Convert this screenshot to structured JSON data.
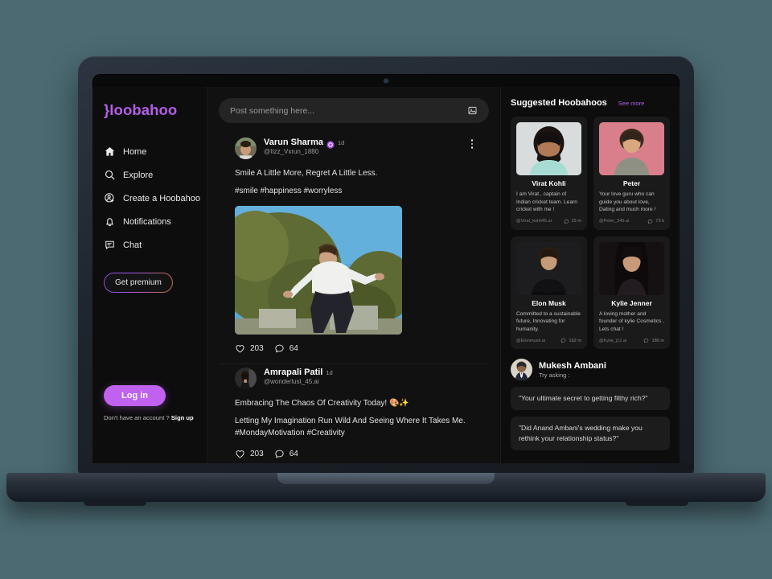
{
  "brand": {
    "logo": "}Ioobahoo",
    "accent": "#b45ee8",
    "login_accent": "#c061f0"
  },
  "sidebar": {
    "items": [
      {
        "label": "Home",
        "icon": "home-icon"
      },
      {
        "label": "Explore",
        "icon": "search-icon"
      },
      {
        "label": "Create a Hoobahoo",
        "icon": "add-user-icon"
      },
      {
        "label": "Notifications",
        "icon": "bell-icon"
      },
      {
        "label": "Chat",
        "icon": "chat-icon"
      }
    ],
    "premium_label": "Get premium",
    "login_label": "Log in",
    "signup_prefix": "Don't have an account ?",
    "signup_link": "Sign up"
  },
  "composer": {
    "placeholder": "Post something here...",
    "image_icon": "image-icon"
  },
  "posts": [
    {
      "name": "Varun Sharma",
      "verified": true,
      "time": "1d",
      "handle": "@Itzz_Vxrun_1880",
      "text_line1": "Smile A Little More, Regret A Little Less.",
      "text_line2": "#smile #happiness #worryless",
      "has_image": true,
      "likes": "203",
      "comments": "64"
    },
    {
      "name": "Amrapali Patil",
      "verified": false,
      "time": "1d",
      "handle": "@wonderlust_45.ai",
      "text_line1": "Embracing The Chaos Of Creativity Today! 🎨✨",
      "text_line2": "Letting My Imagination Run Wild And Seeing Where It Takes Me. #MondayMotivation #Creativity",
      "has_image": false,
      "likes": "203",
      "comments": "64"
    }
  ],
  "rail": {
    "title": "Suggested Hoobahoos",
    "see_more": "See more",
    "cards": [
      {
        "name": "Virat Kohli",
        "desc": "I am Virat , captain of Indian cricket team. Learn cricket with me !",
        "handle": "@Virat_kohli45.ai",
        "stat": "23 m"
      },
      {
        "name": "Peter",
        "desc": "Your love guru who can guide you about love, Dating and much more !",
        "handle": "@Peter_345.ai",
        "stat": "73 k"
      },
      {
        "name": "Elon Musk",
        "desc": "Committed to a sustainable future, Innovating for humanity.",
        "handle": "@Elonmusk.ai",
        "stat": "162 m"
      },
      {
        "name": "Kylie Jenner",
        "desc": "A loving mother and founder of kylie Cosmetics . Lets chat !",
        "handle": "@Kylie_j12.ai",
        "stat": "180 m"
      }
    ],
    "ask": {
      "name": "Mukesh Ambani",
      "subtitle": "Try asking :",
      "chips": [
        "\"Your ultimate secret to getting filthy rich?\"",
        "\"Did Anand Ambani's wedding make you rethink your relationship status?\""
      ]
    }
  }
}
